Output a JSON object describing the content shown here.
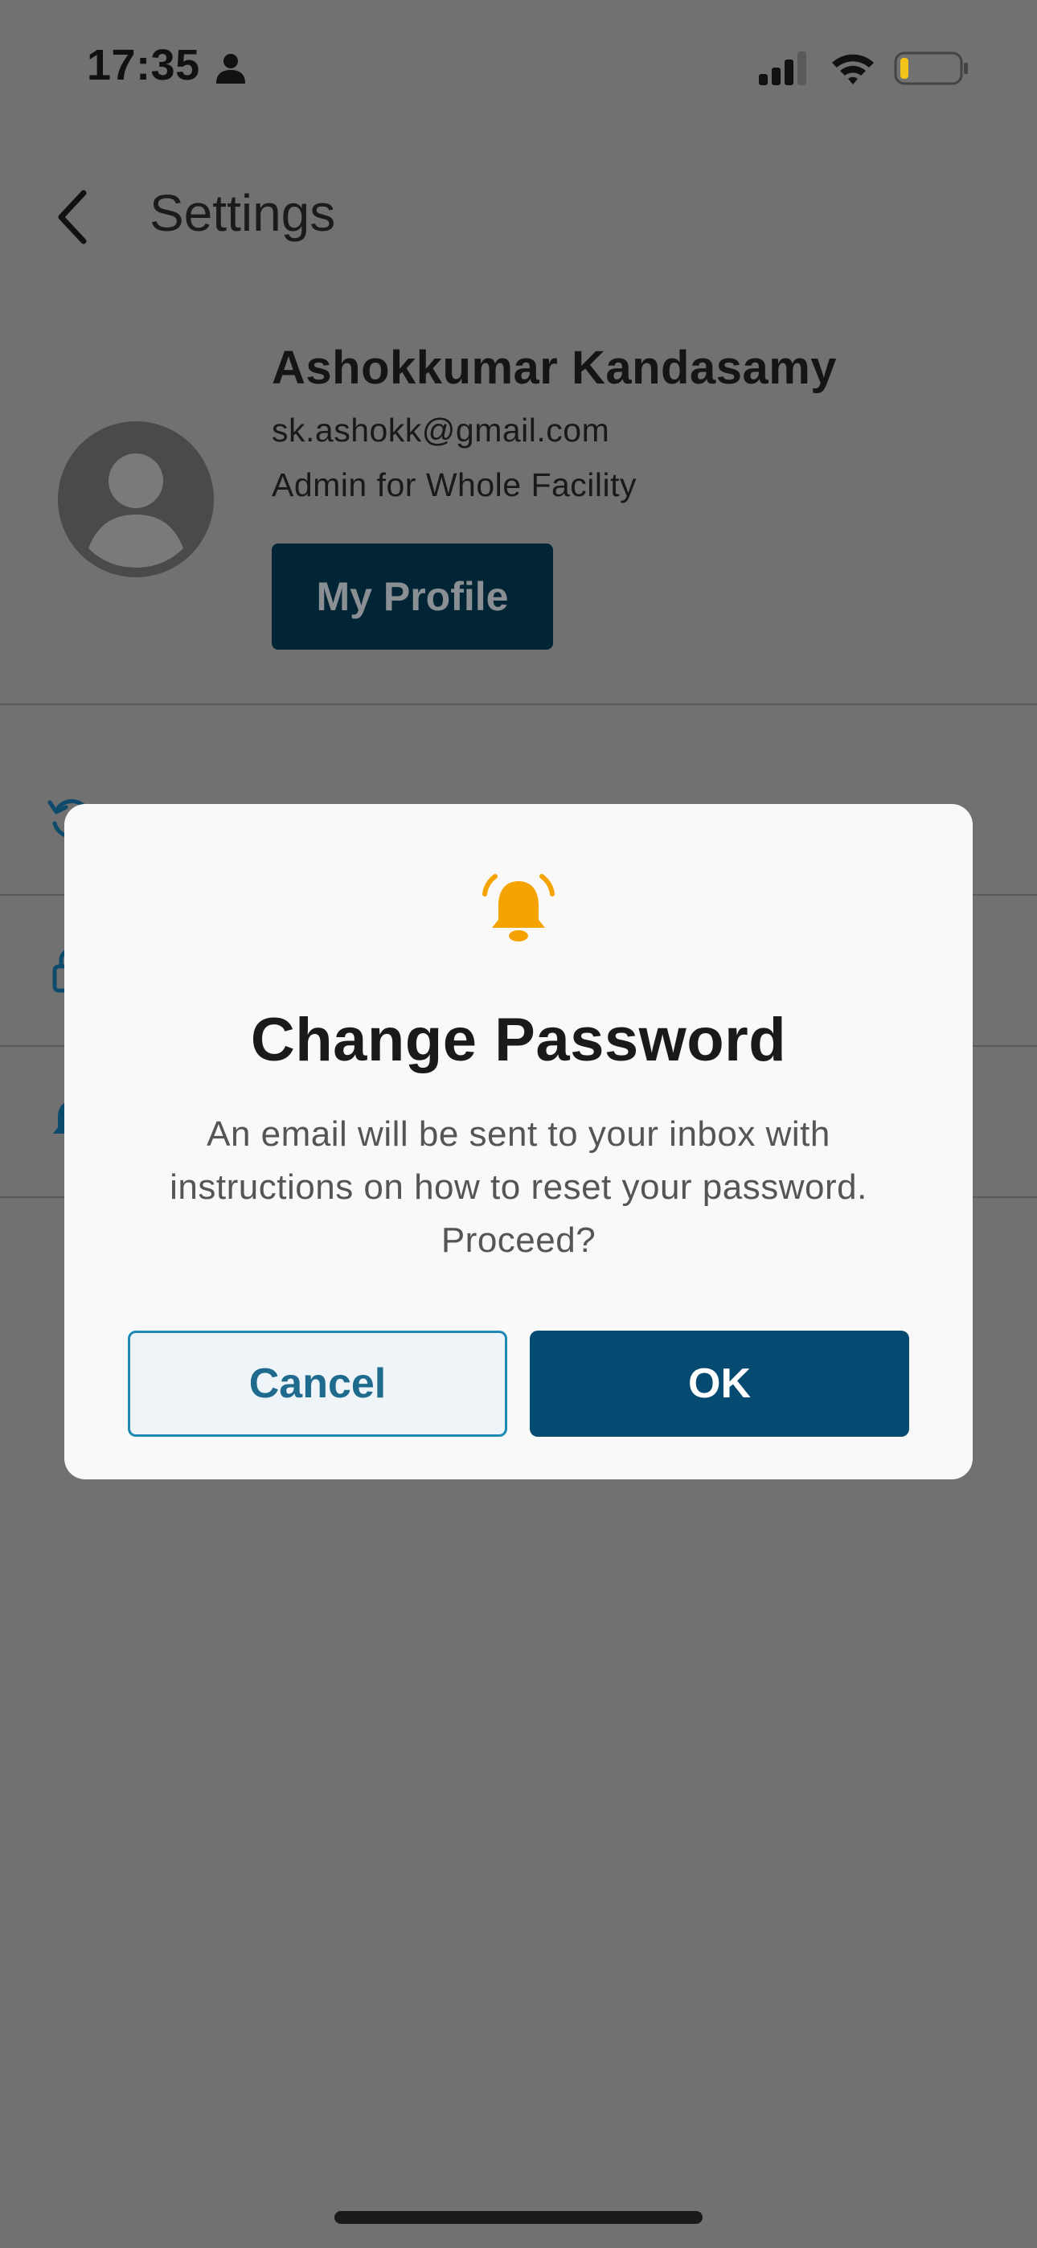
{
  "status_bar": {
    "time": "17:35",
    "icons": [
      "person-icon",
      "signal-icon",
      "wifi-icon",
      "battery-icon"
    ],
    "battery_color": "#f2c318"
  },
  "header": {
    "back_icon": "chevron-left-icon",
    "title": "Settings"
  },
  "profile": {
    "name": "Ashokkumar Kandasamy",
    "email": "sk.ashokk@gmail.com",
    "role": "Admin for Whole Facility",
    "button_label": "My Profile"
  },
  "settings_list": {
    "icons": [
      "refresh-icon",
      "lock-icon",
      "bell-icon"
    ]
  },
  "modal": {
    "icon": "bell-icon",
    "icon_color": "#f5a300",
    "title": "Change Password",
    "message": "An email will be sent to your inbox with instructions on how to reset your password. Proceed?",
    "cancel_label": "Cancel",
    "ok_label": "OK",
    "ok_color": "#044a71",
    "cancel_border_color": "#1e8ab3"
  }
}
